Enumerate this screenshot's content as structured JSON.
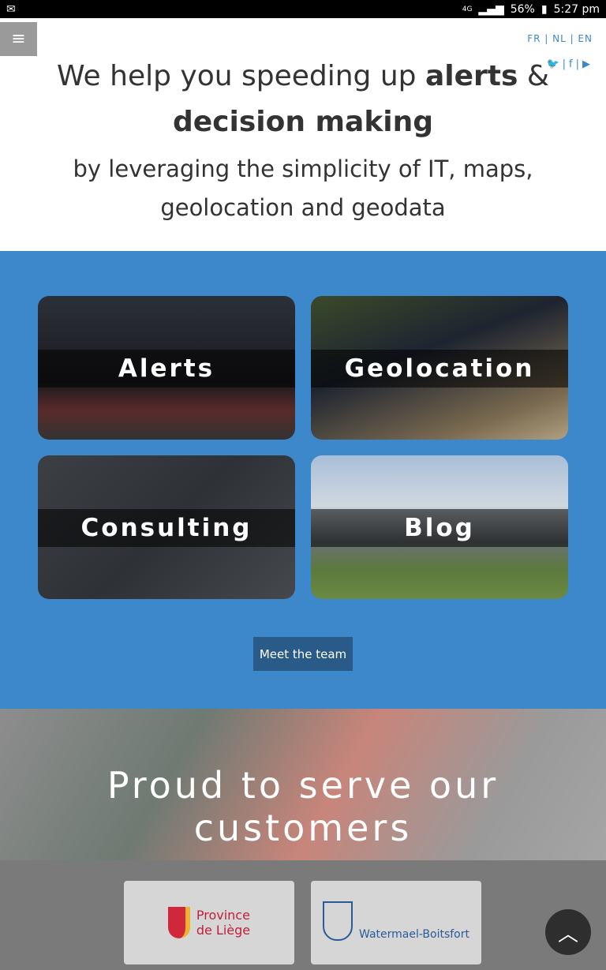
{
  "status": {
    "battery": "56%",
    "time": "5:27 pm",
    "network": "4G"
  },
  "header": {
    "languages": "FR | NL | EN",
    "social": [
      "twitter-icon",
      "facebook-icon",
      "youtube-icon"
    ]
  },
  "hero": {
    "title_part1": "We help you speeding up ",
    "title_bold1": "alerts",
    "title_amp": " & ",
    "title_bold2": "decision making",
    "subtitle": "by leveraging the simplicity of IT, maps, geolocation and geodata"
  },
  "tiles": [
    {
      "label": "Alerts"
    },
    {
      "label": "Geolocation"
    },
    {
      "label": "Consulting"
    },
    {
      "label": "Blog"
    }
  ],
  "team_button": "Meet the team",
  "customers": {
    "title": "Proud to serve our customers",
    "logos": [
      {
        "line1": "Province",
        "line2": "de Liège"
      },
      {
        "name": "Watermael-Boitsfort"
      }
    ]
  },
  "colors": {
    "accent": "#3d87cb",
    "button": "#2a5a87"
  }
}
